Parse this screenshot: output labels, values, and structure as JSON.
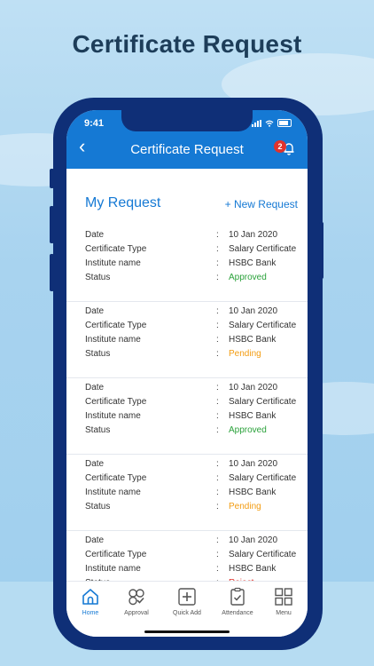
{
  "headline": "Certificate Request",
  "status_bar": {
    "time": "9:41"
  },
  "appbar": {
    "title": "Certificate Request",
    "notification_count": "2"
  },
  "my_request": {
    "title": "My Request",
    "new_request_label": "+ New Request"
  },
  "colon": ":",
  "labels": {
    "date": "Date",
    "type": "Certificate Type",
    "institute": "Institute name",
    "status": "Status"
  },
  "requests": [
    {
      "date": "10 Jan 2020",
      "type": "Salary Certificate",
      "institute": "HSBC Bank",
      "status": "Approved"
    },
    {
      "date": "10 Jan 2020",
      "type": "Salary Certificate",
      "institute": "HSBC Bank",
      "status": "Pending"
    },
    {
      "date": "10 Jan 2020",
      "type": "Salary Certificate",
      "institute": "HSBC Bank",
      "status": "Approved"
    },
    {
      "date": "10 Jan 2020",
      "type": "Salary Certificate",
      "institute": "HSBC Bank",
      "status": "Pending"
    },
    {
      "date": "10 Jan 2020",
      "type": "Salary Certificate",
      "institute": "HSBC Bank",
      "status": "Reject"
    }
  ],
  "tabs": [
    {
      "label": "Home",
      "icon": "home-icon"
    },
    {
      "label": "Approval",
      "icon": "approval-icon"
    },
    {
      "label": "Quick Add",
      "icon": "quick-add-icon"
    },
    {
      "label": "Attendance",
      "icon": "attendance-icon"
    },
    {
      "label": "Menu",
      "icon": "menu-grid-icon"
    }
  ],
  "colors": {
    "primary": "#1579d4",
    "approved": "#2aa13a",
    "pending": "#f39c12",
    "reject": "#e0322c",
    "phone_frame": "#0f2f77"
  }
}
